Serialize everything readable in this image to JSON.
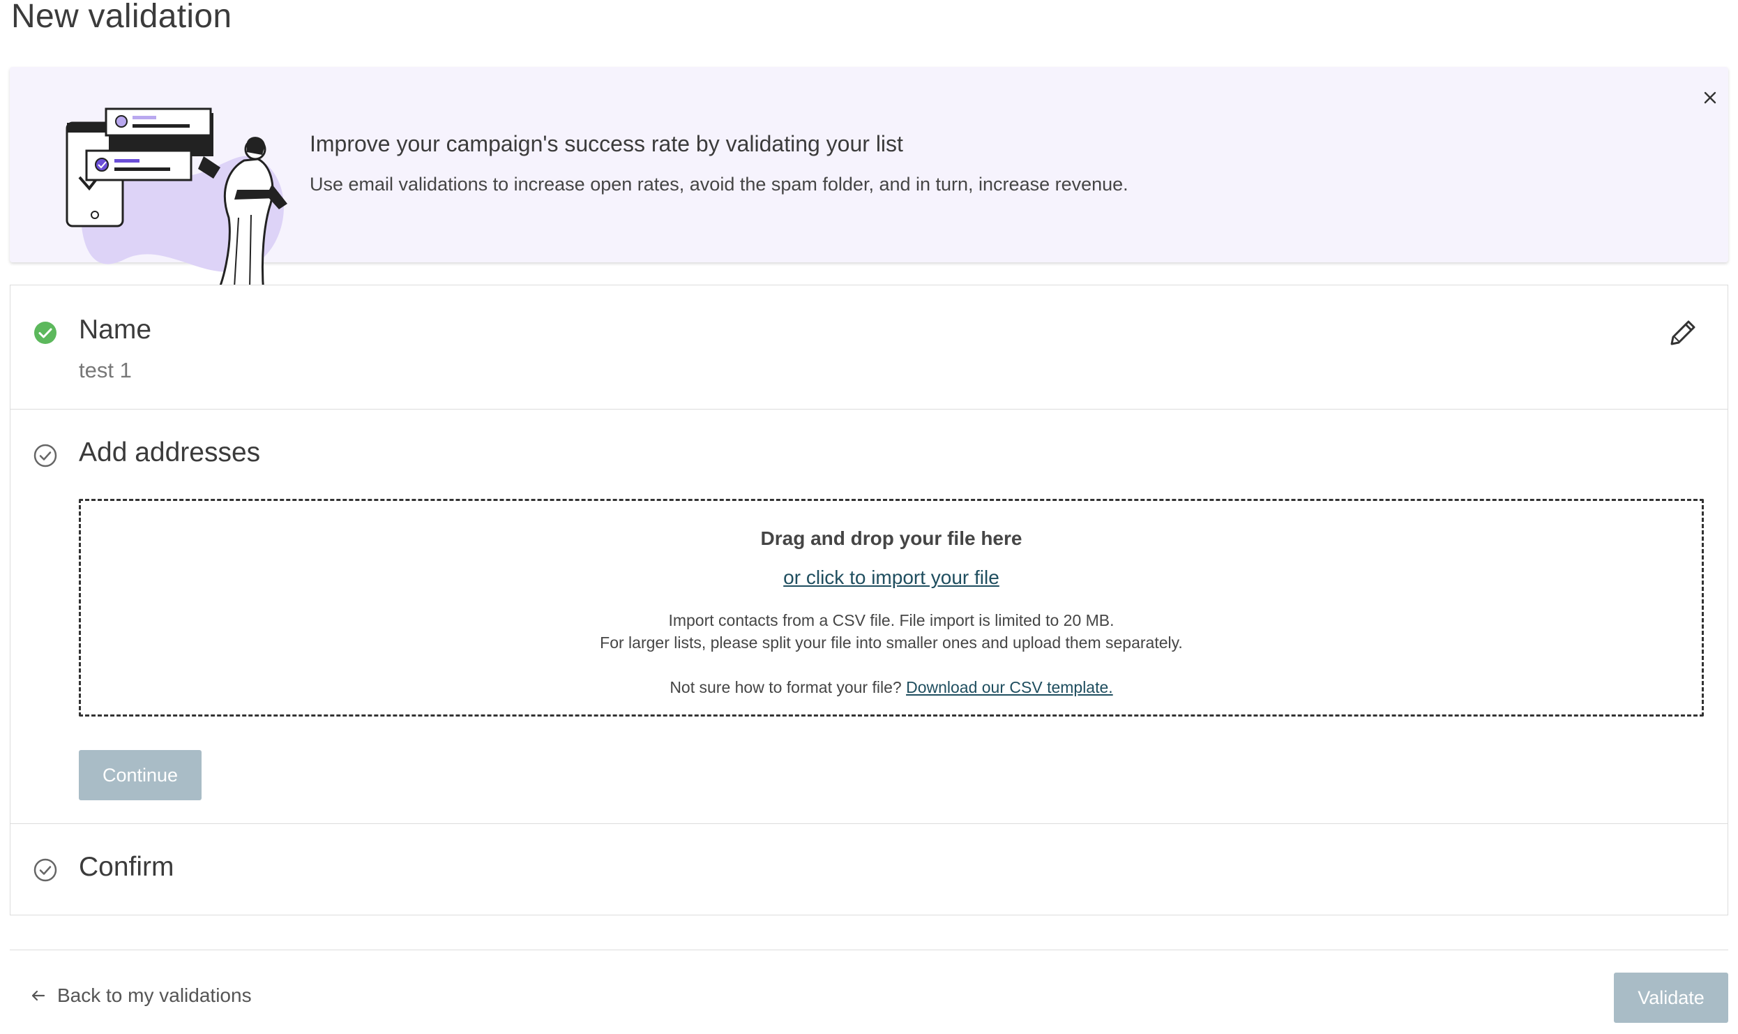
{
  "page": {
    "title": "New validation"
  },
  "banner": {
    "headline": "Improve your campaign's success rate by validating your list",
    "text": "Use email validations to increase open rates, avoid the spam folder, and in turn, increase revenue.",
    "close_icon": "close-icon",
    "accent_color": "#6b4fd8"
  },
  "steps": {
    "name": {
      "title": "Name",
      "value": "test 1",
      "status": "complete",
      "status_color": "#5cb85c",
      "edit_icon": "pencil-icon"
    },
    "addresses": {
      "title": "Add addresses",
      "status": "pending",
      "dropzone": {
        "title": "Drag and drop your file here",
        "link": "or click to import your file",
        "info_line1": "Import contacts from a CSV file. File import is limited to 20 MB.",
        "info_line2": "For larger lists, please split your file into smaller ones and upload them separately.",
        "help_text": "Not sure how to format your file?",
        "help_link": "Download our CSV template."
      },
      "continue_label": "Continue"
    },
    "confirm": {
      "title": "Confirm",
      "status": "pending"
    }
  },
  "footer": {
    "back_label": "Back to my validations",
    "validate_label": "Validate"
  },
  "colors": {
    "disabled_button": "#a9bcc6",
    "link": "#1f4e5f",
    "banner_bg": "#f6f3fd"
  }
}
